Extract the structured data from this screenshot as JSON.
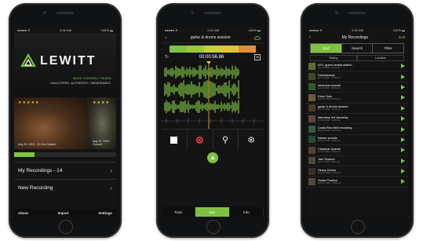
{
  "phone1": {
    "status": {
      "carrier": "●●●●● ≋",
      "time": "9:41 AM",
      "battery": "100% ▬"
    },
    "brand": "LEWITT",
    "tagline": "MAKE YOURSELF HEARD",
    "subtagline": "UNALTERED. AUTHENTIC. MEMORABLE.",
    "photo_a": {
      "stars": "★★★★★",
      "date": "Aug 25, 2015 · Oh Kuo Quartet"
    },
    "photo_b": {
      "stars": "★★★★",
      "date": "Aug 25, 2015 · Concert"
    },
    "storage_fill_pct": 20,
    "menu": [
      {
        "label": "My Recordings - 14",
        "chevron": "›"
      },
      {
        "label": "New Recording",
        "chevron": "›"
      }
    ],
    "footer": [
      "About",
      "Import",
      "Settings"
    ],
    "accent": "#7fc241"
  },
  "phone2": {
    "status": {
      "carrier": "●●●●● ≋",
      "time": "9:41 AM",
      "battery": "100% ▬"
    },
    "title": "guitar & drums session",
    "back": "‹",
    "time": "00:00:56.86",
    "track_icon": "M",
    "loop_icon": "↻",
    "wave_icon": "⌇",
    "controls": [
      "stop",
      "record",
      "marker",
      "settings"
    ],
    "upload_icon": "▲",
    "tabs": [
      {
        "label": "Tools",
        "active": false
      },
      {
        "label": "Rec",
        "active": true
      },
      {
        "label": "Info",
        "active": false
      }
    ],
    "colorbar": [
      "#7fc241",
      "#9cc83c",
      "#c8d13a",
      "#e0c33a",
      "#e08e3a"
    ]
  },
  "phone3": {
    "status": {
      "carrier": "●●●●● ≋",
      "time": "9:41 AM",
      "battery": "100% ▬"
    },
    "title": "My Recordings",
    "back": "‹",
    "edit": "Edit",
    "segments": [
      {
        "label": "Sort",
        "active": true
      },
      {
        "label": "Search",
        "active": false
      },
      {
        "label": "Filter",
        "active": false
      }
    ],
    "sort": [
      "Rating",
      "Location"
    ],
    "recordings": [
      {
        "title": "NYC grand central station",
        "sub": "Jan 12, 2015 · 03:41 min"
      },
      {
        "title": "Drumsession",
        "sub": "Jan 14, 2015 · 12:05 min"
      },
      {
        "title": "rainforest sounds",
        "sub": "Jan 20, 2015 · 08:22 min"
      },
      {
        "title": "Drum Solo",
        "sub": "Feb 02, 2015 · 02:10 min"
      },
      {
        "title": "guitar & drums session",
        "sub": "Feb 11, 2015 · 05:47 min"
      },
      {
        "title": "Interview: Art Vandelay",
        "sub": "Feb 19, 2015 · 14:30 min"
      },
      {
        "title": "Costa Rica field recording",
        "sub": "Mar 03, 2015 · 22:14 min"
      },
      {
        "title": "Nature sounds",
        "sub": "Mar 18, 2015 · 09:05 min"
      },
      {
        "title": "Classical Quartet",
        "sub": "Apr 02, 2015 · 31:40 min"
      },
      {
        "title": "Jam Session",
        "sub": "Apr 15, 2015 · 18:12 min"
      },
      {
        "title": "Heavy Drums",
        "sub": "May 01, 2015 · 04:33 min"
      },
      {
        "title": "Guitar Practice",
        "sub": "May 09, 2015 · 07:58 min"
      }
    ]
  }
}
